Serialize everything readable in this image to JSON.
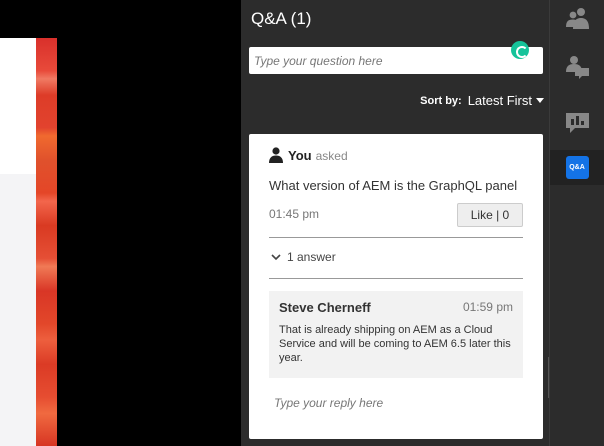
{
  "qa": {
    "title": "Q&A (1)",
    "question_placeholder": "Type your question here",
    "sort_label": "Sort by:",
    "sort_value": "Latest First"
  },
  "question": {
    "author": "You",
    "asked": "asked",
    "text": "What version of AEM is the GraphQL panel",
    "time": "01:45 pm",
    "like_label": "Like | 0",
    "answers_toggle": "1 answer"
  },
  "answer": {
    "author": "Steve Cherneff",
    "time": "01:59 pm",
    "text": "That is already shipping on AEM as a Cloud Service and will be coming to AEM 6.5 later this year."
  },
  "reply": {
    "placeholder": "Type your reply here"
  },
  "toolbar": {
    "items": [
      {
        "icon": "attendees-icon"
      },
      {
        "icon": "chat-icon"
      },
      {
        "icon": "poll-icon"
      },
      {
        "icon": "qa-icon",
        "label": "Q&A",
        "active": true
      }
    ]
  },
  "colors": {
    "panel_bg": "#2c2c2c",
    "accent_blue": "#1473e6",
    "grammarly_green": "#15c39a"
  }
}
